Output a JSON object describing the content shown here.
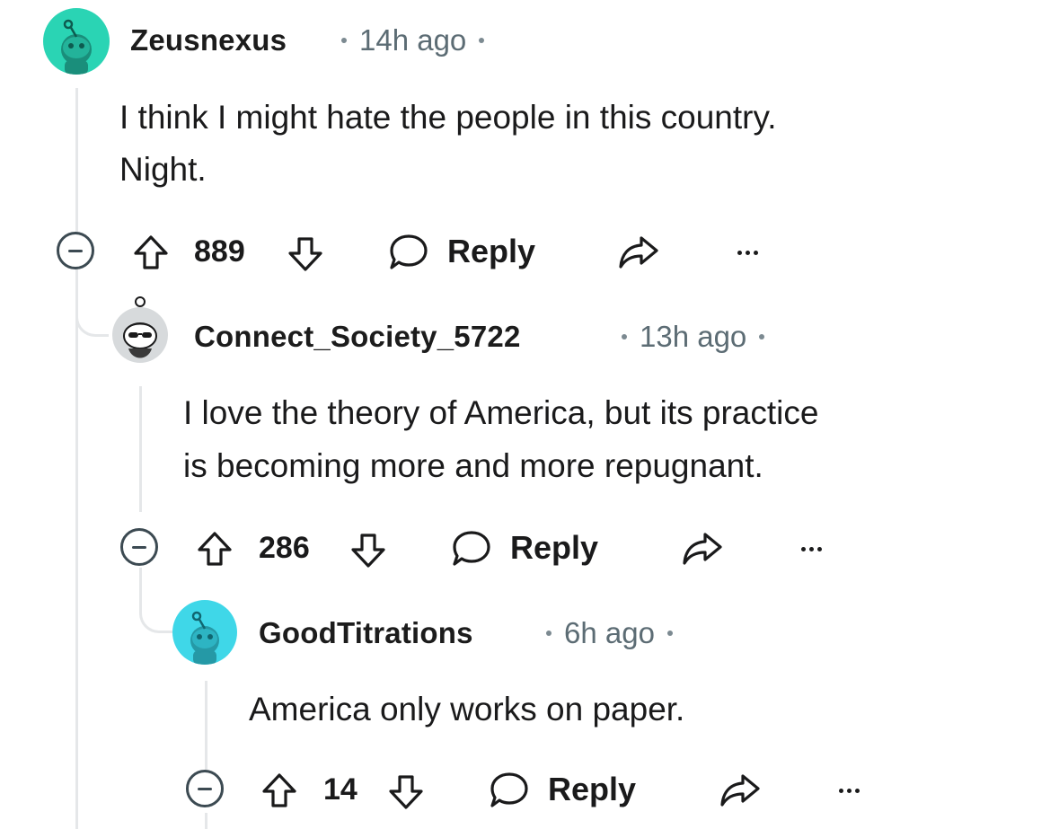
{
  "comments": [
    {
      "username": "Zeusnexus",
      "time": "14h ago",
      "body_lines": [
        "I think I might hate the people in this country.",
        "Night."
      ],
      "score": "889",
      "reply_label": "Reply",
      "avatar_icon": "snoo-avatar-icon",
      "avatar_color": "#2ad4b4"
    },
    {
      "username": "Connect_Society_5722",
      "time": "13h ago",
      "body_lines": [
        "I love the theory of America, but its practice",
        "is becoming more and more repugnant."
      ],
      "score": "286",
      "reply_label": "Reply",
      "avatar_icon": "snoo-sunglasses-avatar-icon",
      "avatar_color": "#d7dadc"
    },
    {
      "username": "GoodTitrations",
      "time": "6h ago",
      "body_lines": [
        "America only works on paper."
      ],
      "score": "14",
      "reply_label": "Reply",
      "avatar_icon": "snoo-avatar-icon",
      "avatar_color": "#3fd7e8"
    }
  ],
  "colors": {
    "text": "#1a1a1b",
    "meta": "#5c6c74",
    "thread_line": "#e5e7e9"
  }
}
